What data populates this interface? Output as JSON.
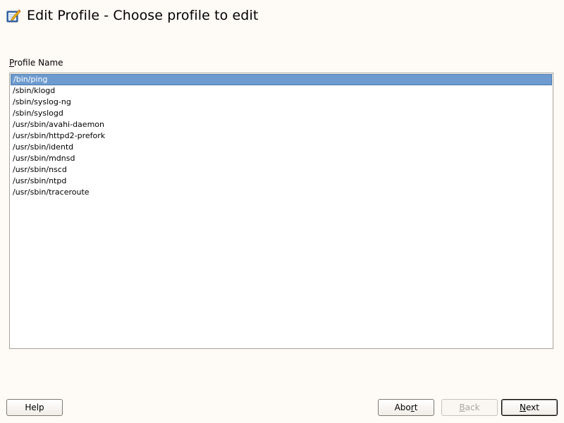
{
  "header": {
    "title": "Edit Profile - Choose profile to edit",
    "icon": "edit-notepad-icon"
  },
  "profile_list": {
    "label_first": "P",
    "label_rest": "rofile Name",
    "selected_index": 0,
    "items": [
      "/bin/ping",
      "/sbin/klogd",
      "/sbin/syslog-ng",
      "/sbin/syslogd",
      "/usr/sbin/avahi-daemon",
      "/usr/sbin/httpd2-prefork",
      "/usr/sbin/identd",
      "/usr/sbin/mdnsd",
      "/usr/sbin/nscd",
      "/usr/sbin/ntpd",
      "/usr/sbin/traceroute"
    ]
  },
  "buttons": {
    "help": "Help",
    "abort_pre": "Abo",
    "abort_mn": "r",
    "abort_post": "t",
    "back_mn": "B",
    "back_post": "ack",
    "next_mn": "N",
    "next_post": "ext"
  },
  "colors": {
    "background": "#fefaf5",
    "selection": "#6d9bcf"
  }
}
